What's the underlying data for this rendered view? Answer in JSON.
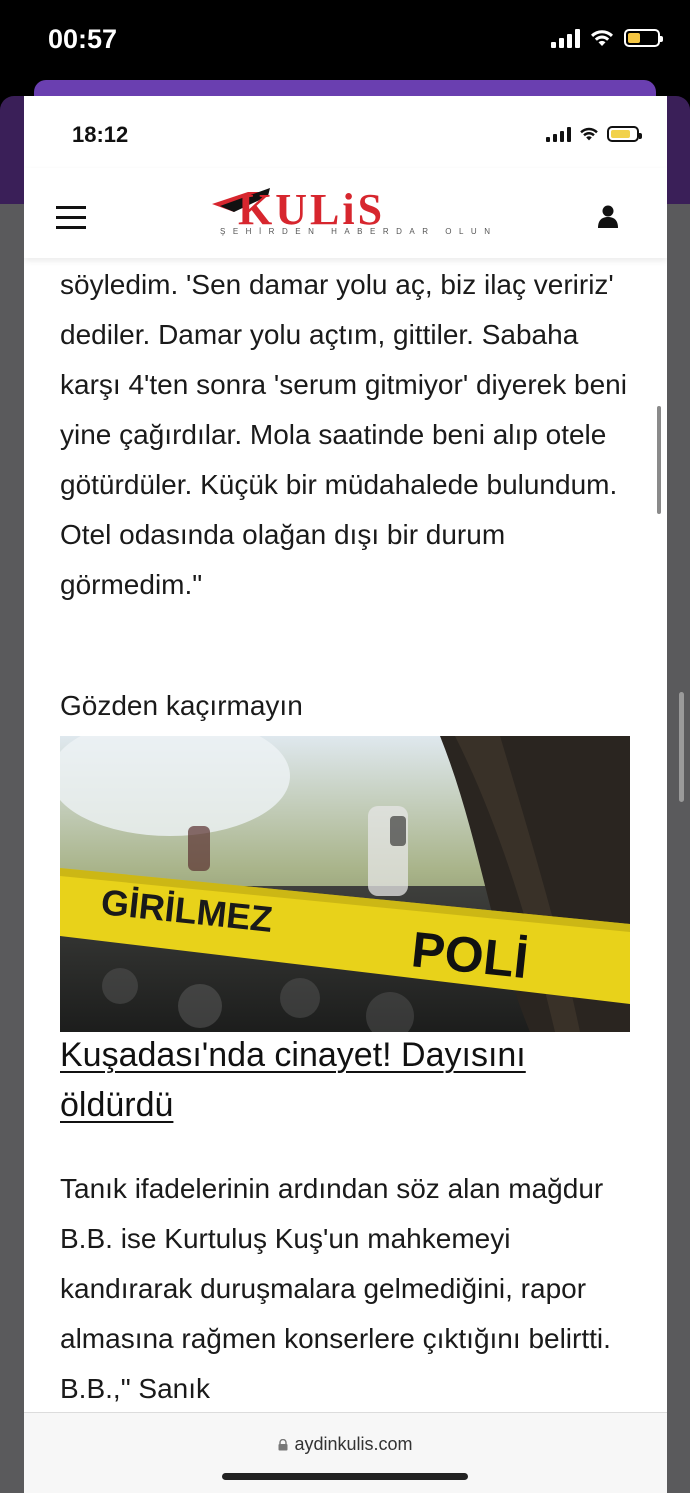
{
  "outer_status": {
    "time": "00:57"
  },
  "inner_status": {
    "time": "18:12"
  },
  "header": {
    "logo_text": "KULiS",
    "logo_tagline": "ŞEHİRDEN HABERDAR OLUN"
  },
  "article": {
    "paragraph_1": "söyledim. 'Sen damar yolu aç, biz ilaç veririz' dediler. Damar yolu açtım, gittiler. Sabaha karşı 4'ten sonra 'serum gitmiyor' diyerek beni yine çağırdılar. Mola saatinde beni alıp otele götürdüler. Küçük bir müdahalede bulundum. Otel odasında olağan dışı bir durum görmedim.\"",
    "section_label": "Gözden kaçırmayın",
    "image_tape_text_1": "GİRİLMEZ",
    "image_tape_text_2": "POLİ",
    "headline": "Kuşadası'nda cinayet! Dayısını öldürdü",
    "paragraph_2": "Tanık ifadelerinin ardından söz alan mağdur B.B. ise Kurtuluş Kuş'un mahkemeyi kandırarak duruşmalara gelmediğini, rapor almasına rağmen konserlere çıktığını belirtti. B.B.,\" Sanık"
  },
  "browser": {
    "url": "aydinkulis.com"
  },
  "colors": {
    "brand_red": "#d7262e",
    "purple_header": "#6a3fb0",
    "tape_yellow": "#e8d21a"
  }
}
